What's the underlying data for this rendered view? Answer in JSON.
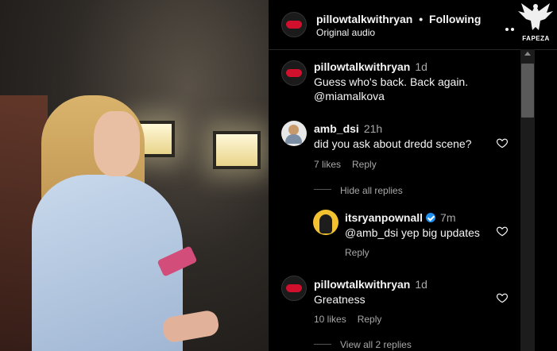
{
  "header": {
    "username": "pillowtalkwithryan",
    "separator": "•",
    "follow_status": "Following",
    "subtitle": "Original audio",
    "more_icon": "more-horizontal-icon"
  },
  "watermark": {
    "label": "FAPEZA",
    "icon": "angel-wings-icon"
  },
  "caption": {
    "username": "pillowtalkwithryan",
    "time": "1d",
    "line1": "Guess who's back. Back again.",
    "line2": "@miamalkova"
  },
  "comments": [
    {
      "username": "amb_dsi",
      "time": "21h",
      "text": "did you ask about dredd scene?",
      "likes": "7 likes",
      "reply": "Reply",
      "toggle_replies": "Hide all replies"
    },
    {
      "username": "itsryanpownall",
      "verified": true,
      "time": "7m",
      "text": "@amb_dsi yep big updates",
      "reply": "Reply"
    },
    {
      "username": "pillowtalkwithryan",
      "time": "1d",
      "text": "Greatness",
      "likes": "10 likes",
      "reply": "Reply",
      "toggle_replies": "View all 2 replies"
    }
  ],
  "colors": {
    "background": "#000000",
    "text": "#f5f5f5",
    "secondary": "#a8a8a8",
    "verified": "#1f8ff0",
    "brand_red": "#d0102c"
  }
}
